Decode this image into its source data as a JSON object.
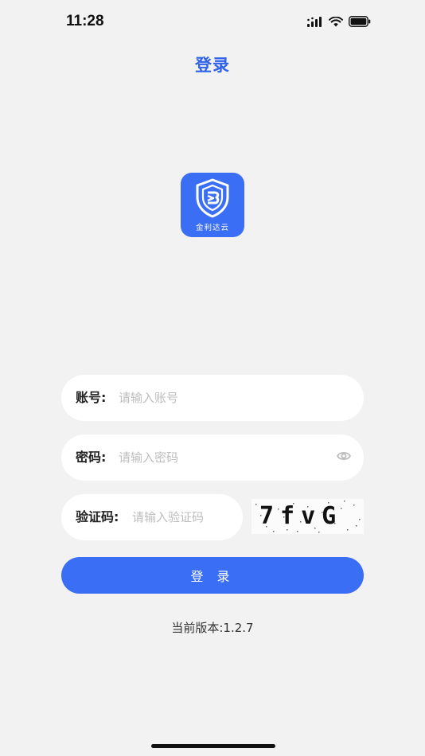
{
  "status_bar": {
    "time": "11:28"
  },
  "nav": {
    "title": "登录"
  },
  "logo": {
    "text": "金利达云"
  },
  "form": {
    "account": {
      "label": "账号:",
      "placeholder": "请输入账号",
      "value": ""
    },
    "password": {
      "label": "密码:",
      "placeholder": "请输入密码",
      "value": ""
    },
    "captcha": {
      "label": "验证码:",
      "placeholder": "请输入验证码",
      "value": "",
      "image_text": "7fvG"
    }
  },
  "login_button": {
    "label": "登 录"
  },
  "version": {
    "text": "当前版本:1.2.7"
  },
  "colors": {
    "accent": "#3a6ef5",
    "title": "#2f63e8",
    "background": "#f2f2f2"
  },
  "icons": {
    "eye": "eye-icon",
    "signal": "signal-icon",
    "wifi": "wifi-icon",
    "battery": "battery-icon"
  }
}
